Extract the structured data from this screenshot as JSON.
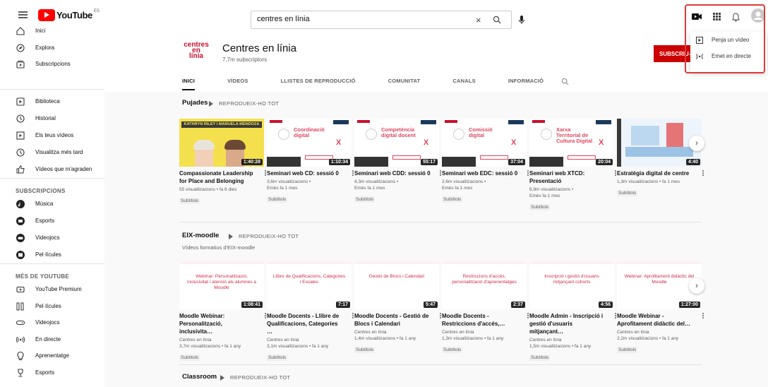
{
  "header": {
    "logo_text": "YouTube",
    "logo_country": "ES",
    "search_value": "centres en línia"
  },
  "upload_menu": {
    "items": [
      "Penja un vídeo",
      "Emet en directe"
    ]
  },
  "sidebar": {
    "main": [
      "Inici",
      "Explora",
      "Subscripcions"
    ],
    "library": [
      "Biblioteca",
      "Historial",
      "Els teus vídeos",
      "Visualitza més tard",
      "Vídeos que m'agraden"
    ],
    "subscriptions_heading": "SUBSCRIPCIONS",
    "subscriptions": [
      "Música",
      "Esports",
      "Videojocs",
      "Pel·lícules"
    ],
    "more_heading": "MÉS DE YOUTUBE",
    "more": [
      "YouTube Premium",
      "Pel·lícules",
      "Videojocs",
      "En directe",
      "Aprenentatge",
      "Esports"
    ]
  },
  "channel": {
    "avatar_lines": [
      "centres",
      "en",
      "línia"
    ],
    "title": "Centres en línia",
    "subscribers": "7,7m subscriptors",
    "subscribe_label": "SUBSCRIU-M",
    "tabs": [
      "INICI",
      "VÍDEOS",
      "LLISTES DE REPRODUCCIÓ",
      "COMUNITAT",
      "CANALS",
      "INFORMACIÓ"
    ]
  },
  "shelves": [
    {
      "title": "Pujades",
      "play_all": "REPRODUEIX-HO TOT",
      "subtitle": "",
      "videos": [
        {
          "thumb_text": "KATHRYN RILEY I MANUELA MENDOZA",
          "duration": "1:40:28",
          "title": "Compassionate Leadership for Place and Belonging",
          "meta": [
            "55 visualitzacions • fa 6 dies"
          ],
          "badge": "Subtítols"
        },
        {
          "thumb_text": "Coordinació digital",
          "duration": "1:10:34",
          "title": "Seminari web CD: sessió 0",
          "meta": [
            "3,6m visualitzacions •",
            "Emès fa 1 mes"
          ],
          "badge": "Subtítols"
        },
        {
          "thumb_text": "Competència digital docent",
          "duration": "55:17",
          "title": "Seminari web CDD: sessió 0",
          "meta": [
            "4,3m visualitzacions •",
            "Emès fa 1 mes"
          ],
          "badge": "Subtítols"
        },
        {
          "thumb_text": "Comissió digital",
          "duration": "37:04",
          "title": "Seminari web EDC: sessió 0",
          "meta": [
            "2,6m visualitzacions •",
            "Emès fa 1 mes"
          ],
          "badge": "Subtítols"
        },
        {
          "thumb_text": "Xarxa Territorial de Cultura Digital",
          "duration": "20:04",
          "title": "Seminari web XTCD: Presentació",
          "meta": [
            "6,9m visualitzacions •",
            "Emès fa 1 mes"
          ],
          "badge": "Subtítols"
        },
        {
          "thumb_text": "",
          "duration": "4:40",
          "title": "Estratègia digital de centre",
          "meta": [
            "1,3m visualitzacions • fa 1 mes"
          ],
          "badge": "Subtítols"
        }
      ]
    },
    {
      "title": "EIX-moodle",
      "play_all": "REPRODUEIX-HO TOT",
      "subtitle": "Vídeos formatius d'EIX-moodle",
      "videos": [
        {
          "thumb_text": "Webinar: Personalització, inclusivitat i atenció als alumnes a Moodle",
          "duration": "1:08:41",
          "title": "Moodle Webinar: Personalització, inclusivita…",
          "meta": [
            "Centres en línia",
            "3,7m visualitzacions • fa 1 any"
          ],
          "badge": "Subtítols"
        },
        {
          "thumb_text": "Llibre de Qualificacions, Categories i Escales",
          "duration": "7:17",
          "title": "Moodle Docents - Llibre de Qualificacions, Categories …",
          "meta": [
            "Centres en línia",
            "3,1m visualitzacions • fa 1 any"
          ],
          "badge": "Subtítols"
        },
        {
          "thumb_text": "Gestió de Blocs i Calendari",
          "duration": "5:47",
          "title": "Moodle Docents - Gestió de Blocs i Calendari",
          "meta": [
            "Centres en línia",
            "1,4m visualitzacions • fa 1 any"
          ],
          "badge": "Subtítols"
        },
        {
          "thumb_text": "Restriccions d'accés, personalització d'aprenentatges",
          "duration": "2:37",
          "title": "Moodle Docents - Restriccions d'accés,…",
          "meta": [
            "Centres en línia",
            "1,3m visualitzacions • fa 1 any"
          ],
          "badge": "Subtítols"
        },
        {
          "thumb_text": "Inscripció i gestió d'usuaris mitjançant cohorts",
          "duration": "4:56",
          "title": "Moodle Admin - Inscripció i gestió d'usuaris mitjançant…",
          "meta": [
            "Centres en línia",
            "1,5m visualitzacions • fa 1 any"
          ],
          "badge": "Subtítols"
        },
        {
          "thumb_text": "Webinar: Aprofitament didàctic del Moodle",
          "duration": "1:27:00",
          "title": "Moodle Webinar - Aprofitament didàctic del…",
          "meta": [
            "Centres en línia",
            "2,2m visualitzacions • fa 1 any"
          ],
          "badge": "Subtítols"
        }
      ]
    },
    {
      "title": "Classroom",
      "play_all": "REPRODUEIX-HO TOT",
      "subtitle": "",
      "videos": []
    }
  ],
  "colors": {
    "brand_red": "#ff0000",
    "subscribe_red": "#cc0000",
    "highlight": "#e03a3a",
    "accent_pink": "#e0455e"
  }
}
